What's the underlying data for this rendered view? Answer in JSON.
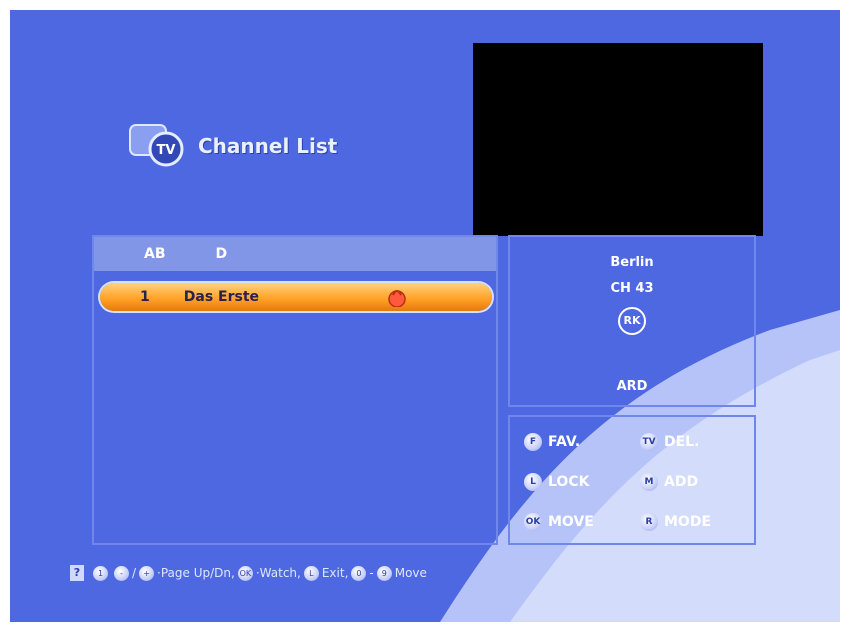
{
  "title": "Channel List",
  "title_icon": "tv-icon",
  "list_header": {
    "icon": "ab-icon",
    "icon_text": "AB",
    "letter": "D"
  },
  "channels": [
    {
      "number": "1",
      "name": "Das Erste",
      "icon": "lock-icon"
    }
  ],
  "info": {
    "city": "Berlin",
    "channel": "CH 43",
    "badge": "RK",
    "provider": "ARD"
  },
  "keys": {
    "fav": {
      "btn": "F",
      "label": "FAV."
    },
    "del": {
      "btn": "TV",
      "label": "DEL."
    },
    "lock": {
      "btn": "L",
      "label": "LOCK"
    },
    "add": {
      "btn": "M",
      "label": "ADD"
    },
    "move": {
      "btn": "OK",
      "label": "MOVE"
    },
    "mode": {
      "btn": "R",
      "label": "MODE"
    }
  },
  "footer": {
    "help": "?",
    "b1": "1",
    "b2": "-",
    "b3": "+",
    "text1": "·Page Up/Dn,",
    "b4": "OK",
    "text2": "·Watch,",
    "b5": "L",
    "text3": "Exit,",
    "b6": "0",
    "text4": "-",
    "b7": "9",
    "text5": "Move"
  },
  "colors": {
    "background": "#4d68e0",
    "highlight": "#ff9f24",
    "panel_border": "#6f86ea"
  }
}
